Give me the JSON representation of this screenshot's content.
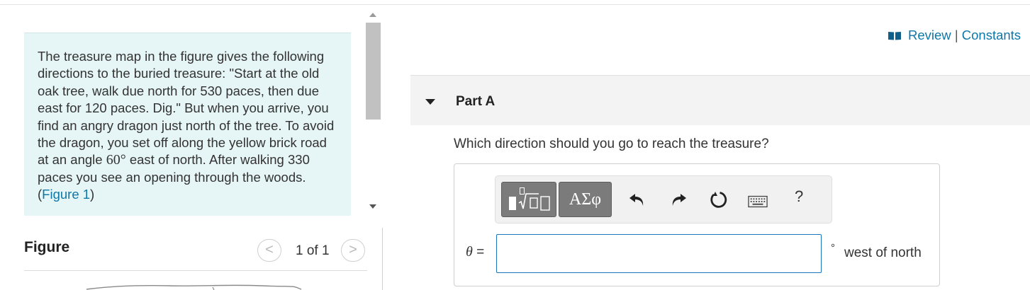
{
  "header": {
    "review_label": "Review",
    "separator": "|",
    "constants_label": "Constants"
  },
  "problem": {
    "text_before": "The treasure map in the figure gives the following directions to the buried treasure: \"Start at the old oak tree, walk due north for 530 paces, then due east for 120 paces. Dig.\" But when you arrive, you find an angry dragon just north of the tree. To avoid the dragon, you set off along the yellow brick road at an angle ",
    "angle_value": "60°",
    "text_after": " east of north. After walking 330 paces you see an opening through the woods. (",
    "figure_link": "Figure 1",
    "text_close": ")"
  },
  "figure": {
    "title": "Figure",
    "counter": "1 of 1",
    "prev_symbol": "<",
    "next_symbol": ">"
  },
  "part": {
    "title": "Part A",
    "question": "Which direction should you go to reach the treasure?"
  },
  "toolbar": {
    "symbols_label": "ΑΣφ",
    "help_label": "?"
  },
  "answer": {
    "variable": "θ",
    "equals": " =",
    "value": "",
    "degree_symbol": "°",
    "unit": "west of north"
  },
  "colors": {
    "link": "#0f77a8",
    "problem_bg": "#e6f5f5",
    "input_border": "#1b75bb",
    "toolbar_button": "#7b7b7b"
  }
}
